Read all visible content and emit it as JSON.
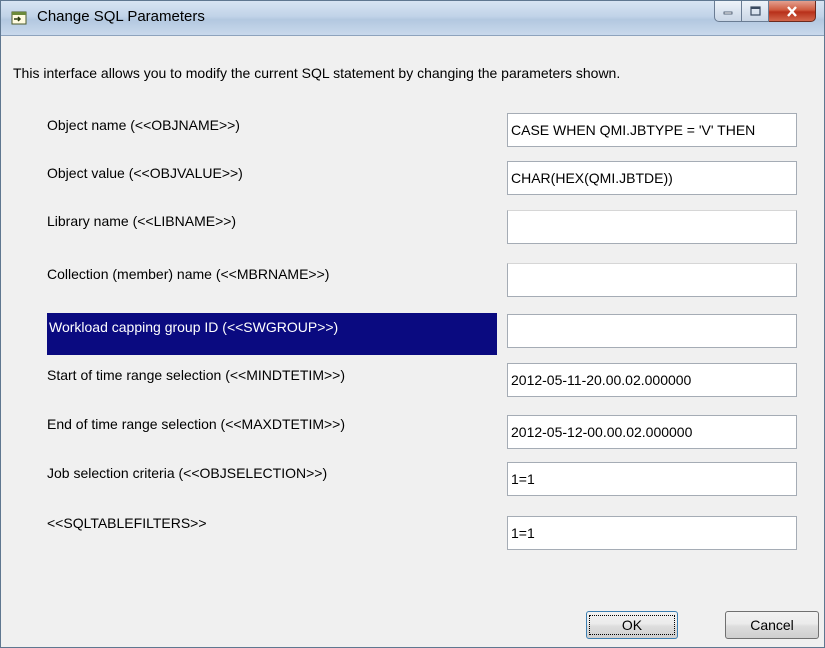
{
  "window": {
    "title": "Change SQL Parameters",
    "description": "This interface allows you to modify the current SQL statement by changing the parameters shown."
  },
  "params": [
    {
      "label": "Object name (<<OBJNAME>>)",
      "value": "CASE WHEN QMI.JBTYPE = 'V' THEN"
    },
    {
      "label": "Object value (<<OBJVALUE>>)",
      "value": "CHAR(HEX(QMI.JBTDE))"
    },
    {
      "label": "Library name (<<LIBNAME>>)",
      "value": ""
    },
    {
      "label": "Collection (member) name (<<MBRNAME>>)",
      "value": ""
    },
    {
      "label": "Workload capping group ID (<<SWGROUP>>)",
      "value": ""
    },
    {
      "label": "Start of time range selection (<<MINDTETIM>>)",
      "value": "2012-05-11-20.00.02.000000"
    },
    {
      "label": "End of time range selection (<<MAXDTETIM>>)",
      "value": "2012-05-12-00.00.02.000000"
    },
    {
      "label": "Job selection criteria (<<OBJSELECTION>>)",
      "value": "1=1"
    },
    {
      "label": "<<SQLTABLEFILTERS>>",
      "value": "1=1"
    }
  ],
  "selected_param_index": 4,
  "buttons": {
    "ok": "OK",
    "cancel": "Cancel"
  },
  "icons": {
    "app": "arrow-into-box-icon",
    "minimize": "minimize-icon",
    "maximize": "maximize-icon",
    "close": "close-icon"
  },
  "colors": {
    "selection": "#0a0a80",
    "close_button": "#c9442a"
  }
}
